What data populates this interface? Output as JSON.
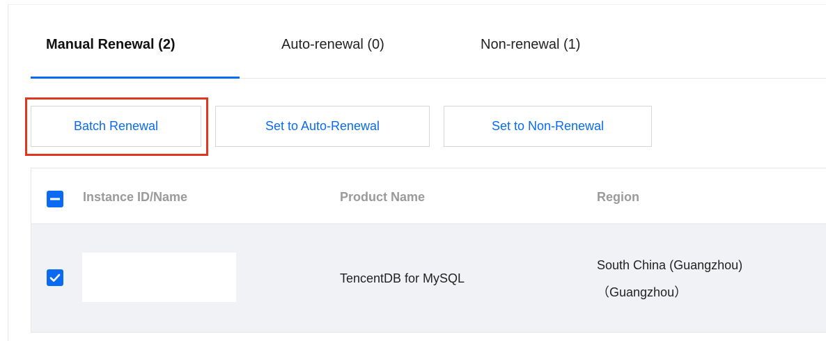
{
  "tabs": [
    {
      "label": "Manual Renewal (2)",
      "active": true
    },
    {
      "label": "Auto-renewal (0)",
      "active": false
    },
    {
      "label": "Non-renewal (1)",
      "active": false
    }
  ],
  "toolbar": {
    "batch_renewal": "Batch Renewal",
    "set_auto_renewal": "Set to Auto-Renewal",
    "set_non_renewal": "Set to Non-Renewal"
  },
  "table": {
    "headers": {
      "instance": "Instance ID/Name",
      "product": "Product Name",
      "region": "Region"
    },
    "rows": [
      {
        "product": "TencentDB for MySQL",
        "region_line1": "South China (Guangzhou)",
        "region_line2": "（Guangzhou）",
        "checked": true
      }
    ]
  },
  "colors": {
    "accent": "#0a6bf2",
    "highlight": "#e0361f",
    "row_selected_bg": "#f1f2f5"
  }
}
